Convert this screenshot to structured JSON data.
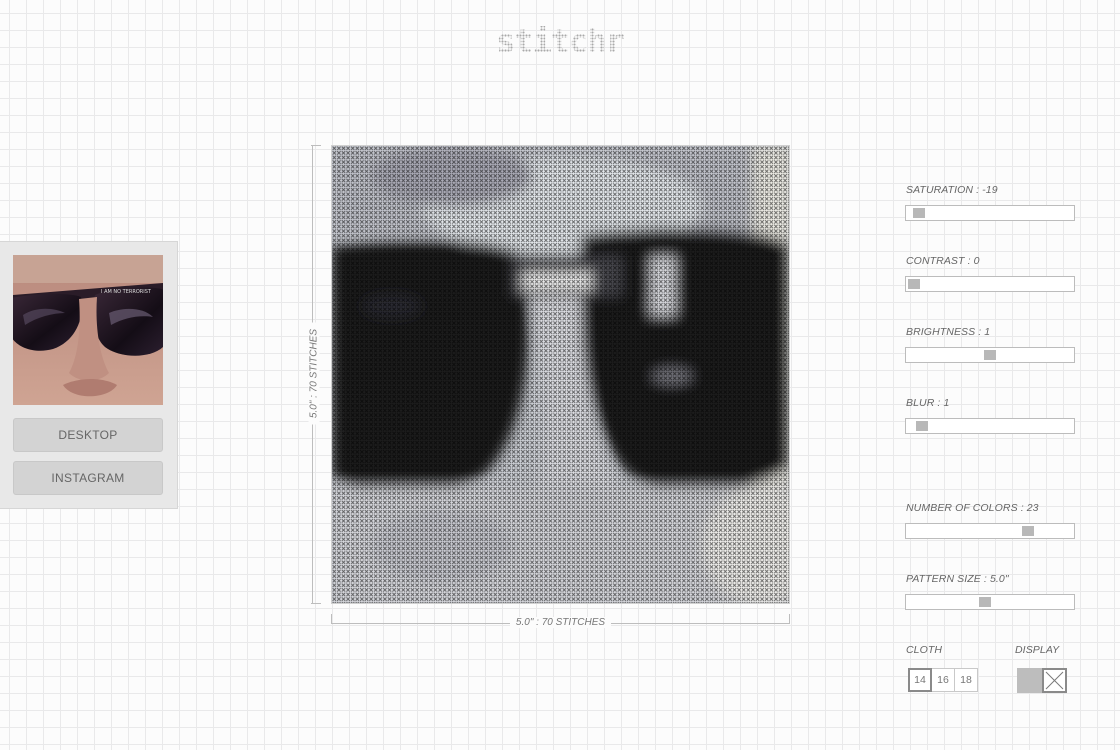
{
  "app": {
    "logo": "stitchr"
  },
  "source": {
    "buttons": {
      "desktop": "DESKTOP",
      "instagram": "INSTAGRAM"
    }
  },
  "pattern": {
    "width_label": "5.0\" : 70 STITCHES",
    "height_label": "5.0\" : 70 STITCHES",
    "stitches": 70
  },
  "controls": {
    "saturation": {
      "label": "SATURATION : -19",
      "level": 0.03
    },
    "contrast": {
      "label": "CONTRAST : 0",
      "level": 0.0
    },
    "brightness": {
      "label": "BRIGHTNESS : 1",
      "level": 0.5
    },
    "blur": {
      "label": "BLUR : 1",
      "level": 0.05
    },
    "colors": {
      "label": "NUMBER OF COLORS : 23",
      "level": 0.75
    },
    "pattern_size": {
      "label": "PATTERN SIZE : 5.0\"",
      "level": 0.47
    }
  },
  "cloth": {
    "label": "CLOTH",
    "options": [
      "14",
      "16",
      "18"
    ],
    "selected": "14"
  },
  "display": {
    "label": "DISPLAY",
    "selected": "cross"
  },
  "colors": {
    "grid": "#e9e9ea",
    "slider_thumb": "#b8b8b8",
    "panel": "#e8e8e8"
  },
  "icons": {
    "thumbnail": "sunglasses-photo",
    "display_cross": "cross-stitch-icon",
    "display_solid": "solid-fill-icon"
  }
}
